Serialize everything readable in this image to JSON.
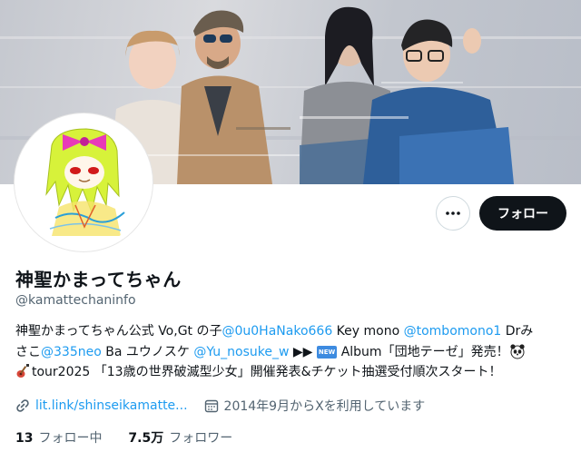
{
  "header": {
    "banner": "band-photo",
    "avatar": "illustrated-girl-avatar"
  },
  "actions": {
    "more_label": "more-dots-icon",
    "follow_label": "フォロー"
  },
  "profile": {
    "display_name": "神聖かまってちゃん",
    "handle": "@kamattechaninfo",
    "bio": {
      "l1_text1": "神聖かまってちゃん公式 Vo,Gt の子",
      "l1_mention1": "@0u0HaNako666",
      "l1_text2": " Key mono ",
      "l1_mention2": "@tombomono1",
      "l1_text3": " Drみ",
      "l2_text1": "さこ",
      "l2_mention1": "@335neo",
      "l2_text2": " Ba ユウノスケ ",
      "l2_mention2": "@Yu_nosuke_w",
      "l2_arrows": " ▶︎▶︎",
      "new_badge": "NEW",
      "l2_text3": " Album「団地テーゼ」発売！",
      "l3_text": "tour2025 「13歳の世界破滅型少女」開催発表&チケット抽選受付順次スタート！"
    },
    "link": "lit.link/shinseikamatte...",
    "joined": "2014年9月からXを利用しています"
  },
  "stats": {
    "following_count": "13",
    "following_label": "フォロー中",
    "followers_count": "7.5万",
    "followers_label": "フォロワー"
  },
  "colors": {
    "accent": "#1d9bf0",
    "text": "#0f1419",
    "muted": "#536471",
    "button": "#0f1419"
  }
}
